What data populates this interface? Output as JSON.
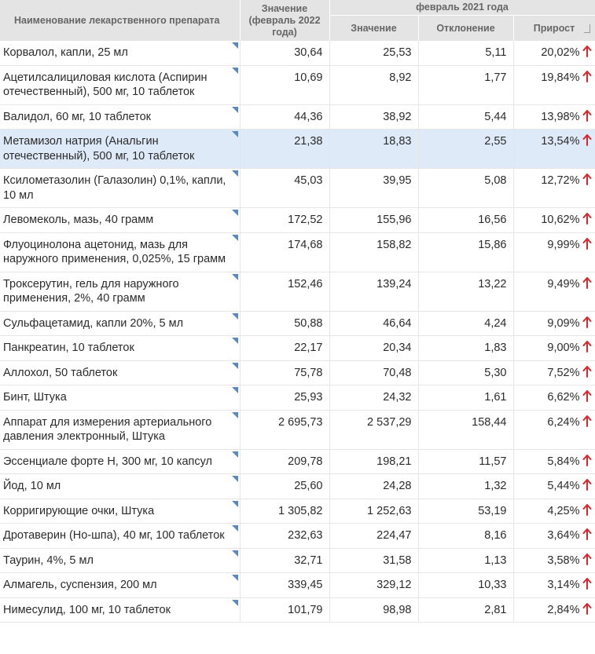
{
  "header": {
    "name_col": "Наименование лекарственного препарата",
    "value_col": "Значение (февраль 2022 года)",
    "group_col": "февраль 2021 года",
    "sub_value": "Значение",
    "sub_deviation": "Отклонение",
    "sub_growth": "Прирост"
  },
  "colors": {
    "up_arrow": "#d9262c",
    "highlight_row": "#dfeaf8",
    "corner_marker": "#5c87bf"
  },
  "icons": {
    "growth": "arrow-up-icon",
    "sort": "sort-icon",
    "corner": "corner-marker-icon"
  },
  "rows": [
    {
      "name": "Корвалол, капли, 25 мл",
      "v2022": "30,64",
      "v2021": "25,53",
      "dev": "5,11",
      "growth": "20,02%"
    },
    {
      "name": "Ацетилсалициловая кислота (Аспирин отечественный), 500 мг, 10 таблеток",
      "v2022": "10,69",
      "v2021": "8,92",
      "dev": "1,77",
      "growth": "19,84%"
    },
    {
      "name": "Валидол, 60 мг, 10 таблеток",
      "v2022": "44,36",
      "v2021": "38,92",
      "dev": "5,44",
      "growth": "13,98%"
    },
    {
      "name": "Метамизол натрия (Анальгин отечественный), 500 мг, 10 таблеток",
      "v2022": "21,38",
      "v2021": "18,83",
      "dev": "2,55",
      "growth": "13,54%",
      "highlight": true
    },
    {
      "name": "Ксилометазолин (Галазолин) 0,1%, капли, 10 мл",
      "v2022": "45,03",
      "v2021": "39,95",
      "dev": "5,08",
      "growth": "12,72%"
    },
    {
      "name": "Левомеколь, мазь, 40 грамм",
      "v2022": "172,52",
      "v2021": "155,96",
      "dev": "16,56",
      "growth": "10,62%"
    },
    {
      "name": "Флуоцинолона ацетонид, мазь для наружного применения, 0,025%, 15 грамм",
      "v2022": "174,68",
      "v2021": "158,82",
      "dev": "15,86",
      "growth": "9,99%"
    },
    {
      "name": "Троксерутин, гель для наружного применения, 2%, 40 грамм",
      "v2022": "152,46",
      "v2021": "139,24",
      "dev": "13,22",
      "growth": "9,49%"
    },
    {
      "name": "Сульфацетамид, капли 20%, 5 мл",
      "v2022": "50,88",
      "v2021": "46,64",
      "dev": "4,24",
      "growth": "9,09%"
    },
    {
      "name": "Панкреатин, 10 таблеток",
      "v2022": "22,17",
      "v2021": "20,34",
      "dev": "1,83",
      "growth": "9,00%"
    },
    {
      "name": "Аллохол, 50 таблеток",
      "v2022": "75,78",
      "v2021": "70,48",
      "dev": "5,30",
      "growth": "7,52%"
    },
    {
      "name": "Бинт, Штука",
      "v2022": "25,93",
      "v2021": "24,32",
      "dev": "1,61",
      "growth": "6,62%"
    },
    {
      "name": "Аппарат для измерения артериального давления электронный, Штука",
      "v2022": "2 695,73",
      "v2021": "2 537,29",
      "dev": "158,44",
      "growth": "6,24%"
    },
    {
      "name": "Эссенциале форте Н, 300 мг, 10 капсул",
      "v2022": "209,78",
      "v2021": "198,21",
      "dev": "11,57",
      "growth": "5,84%"
    },
    {
      "name": "Йод, 10 мл",
      "v2022": "25,60",
      "v2021": "24,28",
      "dev": "1,32",
      "growth": "5,44%"
    },
    {
      "name": "Корригирующие очки, Штука",
      "v2022": "1 305,82",
      "v2021": "1 252,63",
      "dev": "53,19",
      "growth": "4,25%"
    },
    {
      "name": "Дротаверин (Но-шпа), 40 мг, 100 таблеток",
      "v2022": "232,63",
      "v2021": "224,47",
      "dev": "8,16",
      "growth": "3,64%"
    },
    {
      "name": "Таурин, 4%, 5 мл",
      "v2022": "32,71",
      "v2021": "31,58",
      "dev": "1,13",
      "growth": "3,58%"
    },
    {
      "name": "Алмагель, суспензия, 200 мл",
      "v2022": "339,45",
      "v2021": "329,12",
      "dev": "10,33",
      "growth": "3,14%"
    },
    {
      "name": "Нимесулид, 100 мг, 10 таблеток",
      "v2022": "101,79",
      "v2021": "98,98",
      "dev": "2,81",
      "growth": "2,84%"
    }
  ]
}
